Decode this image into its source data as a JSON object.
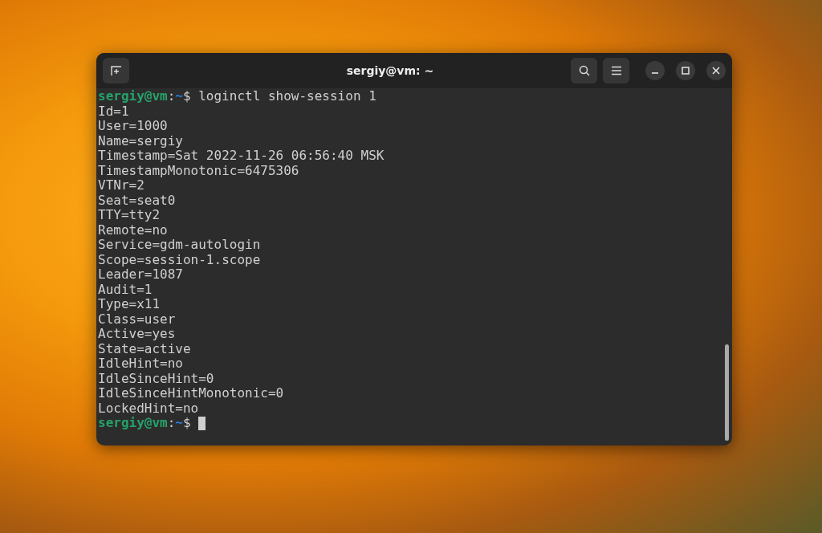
{
  "window": {
    "title": "sergiy@vm: ~"
  },
  "terminal": {
    "lines": [
      {
        "kind": "prompt",
        "user": "sergiy@vm",
        "sep": ":",
        "path": "~",
        "symbol": "$",
        "command": "loginctl show-session 1",
        "cursor": false
      },
      {
        "kind": "output",
        "text": "Id=1"
      },
      {
        "kind": "output",
        "text": "User=1000"
      },
      {
        "kind": "output",
        "text": "Name=sergiy"
      },
      {
        "kind": "output",
        "text": "Timestamp=Sat 2022-11-26 06:56:40 MSK"
      },
      {
        "kind": "output",
        "text": "TimestampMonotonic=6475306"
      },
      {
        "kind": "output",
        "text": "VTNr=2"
      },
      {
        "kind": "output",
        "text": "Seat=seat0"
      },
      {
        "kind": "output",
        "text": "TTY=tty2"
      },
      {
        "kind": "output",
        "text": "Remote=no"
      },
      {
        "kind": "output",
        "text": "Service=gdm-autologin"
      },
      {
        "kind": "output",
        "text": "Scope=session-1.scope"
      },
      {
        "kind": "output",
        "text": "Leader=1087"
      },
      {
        "kind": "output",
        "text": "Audit=1"
      },
      {
        "kind": "output",
        "text": "Type=x11"
      },
      {
        "kind": "output",
        "text": "Class=user"
      },
      {
        "kind": "output",
        "text": "Active=yes"
      },
      {
        "kind": "output",
        "text": "State=active"
      },
      {
        "kind": "output",
        "text": "IdleHint=no"
      },
      {
        "kind": "output",
        "text": "IdleSinceHint=0"
      },
      {
        "kind": "output",
        "text": "IdleSinceHintMonotonic=0"
      },
      {
        "kind": "output",
        "text": "LockedHint=no"
      },
      {
        "kind": "prompt",
        "user": "sergiy@vm",
        "sep": ":",
        "path": "~",
        "symbol": "$",
        "cursor": true
      }
    ]
  }
}
